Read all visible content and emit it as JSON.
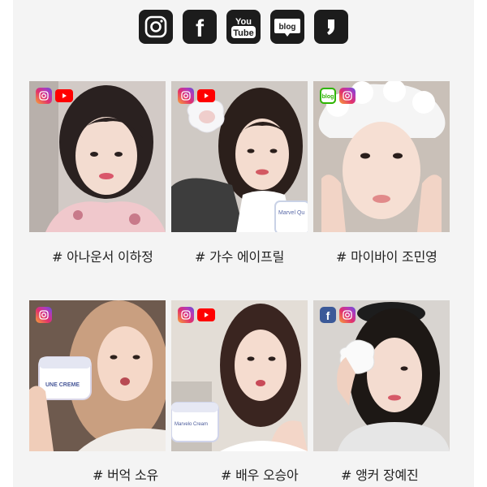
{
  "social_links": [
    {
      "name": "instagram-icon",
      "label": ""
    },
    {
      "name": "facebook-icon",
      "label": "f"
    },
    {
      "name": "youtube-icon",
      "label_top": "You",
      "label_bottom": "Tube"
    },
    {
      "name": "blog-icon",
      "label": "blog"
    },
    {
      "name": "kakao-story-icon",
      "label": ""
    }
  ],
  "cards": [
    {
      "caption": "# 아나운서 이하정",
      "badges": [
        "instagram",
        "youtube"
      ]
    },
    {
      "caption": "# 가수 에이프릴",
      "badges": [
        "instagram",
        "youtube"
      ]
    },
    {
      "caption": "# 마이바이 조민영",
      "badges": [
        "blog",
        "instagram"
      ]
    },
    {
      "caption": "# 버억 소유",
      "badges": [
        "instagram"
      ]
    },
    {
      "caption": "# 배우 오승아",
      "badges": [
        "instagram",
        "youtube"
      ]
    },
    {
      "caption": "# 앵커 장예진",
      "badges": [
        "facebook",
        "instagram"
      ]
    }
  ],
  "badge_labels": {
    "blog": "blog",
    "facebook": "f"
  },
  "product_labels": {
    "jar_a": "Marvel Qu",
    "jar_b": "UNE CREME",
    "jar_c": "Marvelo Cream"
  },
  "colors": {
    "icon_bg": "#1c1c1c",
    "instagram": "#e1306c",
    "youtube": "#ff0000",
    "facebook": "#3b5998",
    "blog": "#2db400"
  }
}
